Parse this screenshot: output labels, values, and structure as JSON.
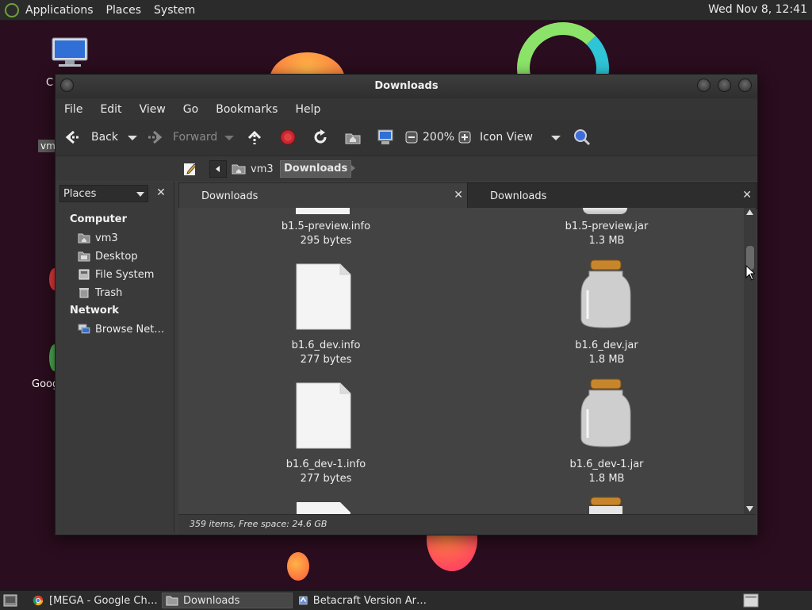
{
  "top_panel": {
    "menus": [
      "Applications",
      "Places",
      "System"
    ],
    "clock": "Wed Nov 8, 12:41"
  },
  "desktop": {
    "labels": [
      "C",
      "vm",
      "Goog"
    ]
  },
  "window": {
    "title": "Downloads",
    "menu": [
      "File",
      "Edit",
      "View",
      "Go",
      "Bookmarks",
      "Help"
    ],
    "toolbar": {
      "back": "Back",
      "forward": "Forward",
      "zoom": "200%",
      "view_mode": "Icon View"
    },
    "location": {
      "crumbs": [
        "vm3",
        "Downloads"
      ]
    },
    "sidebar": {
      "selector": "Places",
      "sections": [
        {
          "heading": "Computer",
          "items": [
            "vm3",
            "Desktop",
            "File System",
            "Trash"
          ]
        },
        {
          "heading": "Network",
          "items": [
            "Browse Net…"
          ]
        }
      ]
    },
    "tabs": [
      "Downloads",
      "Downloads"
    ],
    "files": [
      {
        "name": "b1.5-preview.info",
        "size": "295 bytes",
        "kind": "document"
      },
      {
        "name": "b1.5-preview.jar",
        "size": "1.3 MB",
        "kind": "jar"
      },
      {
        "name": "b1.6_dev.info",
        "size": "277 bytes",
        "kind": "document"
      },
      {
        "name": "b1.6_dev.jar",
        "size": "1.8 MB",
        "kind": "jar"
      },
      {
        "name": "b1.6_dev-1.info",
        "size": "277 bytes",
        "kind": "document"
      },
      {
        "name": "b1.6_dev-1.jar",
        "size": "1.8 MB",
        "kind": "jar"
      }
    ],
    "status": "359 items, Free space: 24.6 GB"
  },
  "taskbar": {
    "tasks": [
      "[MEGA - Google Ch…",
      "Downloads",
      "Betacraft Version Ar…"
    ]
  }
}
